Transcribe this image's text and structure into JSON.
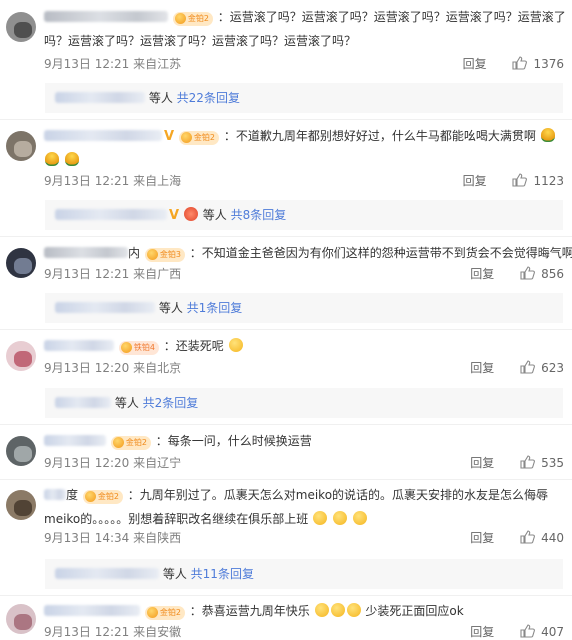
{
  "colors": {
    "link": "#4f7cd9",
    "meta": "#808080",
    "badge_bg": "#ffe8c4",
    "badge_text": "#f08a1a",
    "replybox_bg": "#f7f7f7"
  },
  "comments": [
    {
      "badge": "金铂2",
      "verified": false,
      "text_line1": "：运营滚了吗？运营滚了吗？运营滚了吗？运营滚了吗？运营滚了",
      "text_line2": "吗？运营滚了吗？运营滚了吗？运营滚了吗？运营滚了吗？",
      "date": "9月13日",
      "time": "12:21",
      "location": "来自江苏",
      "reply_label": "回复",
      "likes": "1376",
      "replies": {
        "deng": "等人",
        "count_text": "共22条回复"
      }
    },
    {
      "badge": "金铂2",
      "verified": true,
      "text_line1": "：不道歉九周年都别想好好过，什么牛马都能吆喝大满贯啊",
      "emoji": [
        "flower-emoji",
        "flower-emoji",
        "flower-emoji"
      ],
      "date": "9月13日",
      "time": "12:21",
      "location": "来自上海",
      "reply_label": "回复",
      "likes": "1123",
      "replies": {
        "deng": "等人",
        "count_text": "共8条回复"
      }
    },
    {
      "name_suffix": "内",
      "badge": "金铂3",
      "verified": false,
      "text_line1": "：不知道金主爸爸因为有你们这样的怨种运营带不到货会不会觉得晦气啊",
      "date": "9月13日",
      "time": "12:21",
      "location": "来自广西",
      "reply_label": "回复",
      "likes": "856",
      "replies": {
        "deng": "等人",
        "count_text": "共1条回复"
      }
    },
    {
      "badge": "铁铂4",
      "verified": false,
      "text_line1": "：还装死呢",
      "emoji": [
        "thinking-emoji"
      ],
      "date": "9月13日",
      "time": "12:20",
      "location": "来自北京",
      "reply_label": "回复",
      "likes": "623",
      "replies": {
        "deng": "等人",
        "count_text": "共2条回复"
      }
    },
    {
      "badge": "金铂2",
      "verified": false,
      "text_line1": "：每条一问，什么时候换运营",
      "date": "9月13日",
      "time": "12:20",
      "location": "来自辽宁",
      "reply_label": "回复",
      "likes": "535"
    },
    {
      "name_suffix": "度",
      "badge": "金铂2",
      "verified": false,
      "text_line1": "：九周年别过了。瓜裹天怎么对meiko的说话的。瓜裹天安排的水友是怎么侮辱",
      "text_line2": "meiko的。。。。。别想着辞职改名继续在俱乐部上班",
      "emoji": [
        "upside-down-emoji",
        "upside-down-emoji",
        "upside-down-emoji"
      ],
      "date": "9月13日",
      "time": "14:34",
      "location": "来自陕西",
      "reply_label": "回复",
      "likes": "440",
      "replies": {
        "deng": "等人",
        "count_text": "共11条回复"
      }
    },
    {
      "badge": "金铂2",
      "verified": false,
      "text_line1": "：恭喜运营九周年快乐",
      "text_after_emoji": "少装死正面回应ok",
      "emoji": [
        "smile-emoji",
        "smile-emoji",
        "smile-emoji"
      ],
      "date": "9月13日",
      "time": "12:21",
      "location": "来自安徽",
      "reply_label": "回复",
      "likes": "407"
    }
  ]
}
